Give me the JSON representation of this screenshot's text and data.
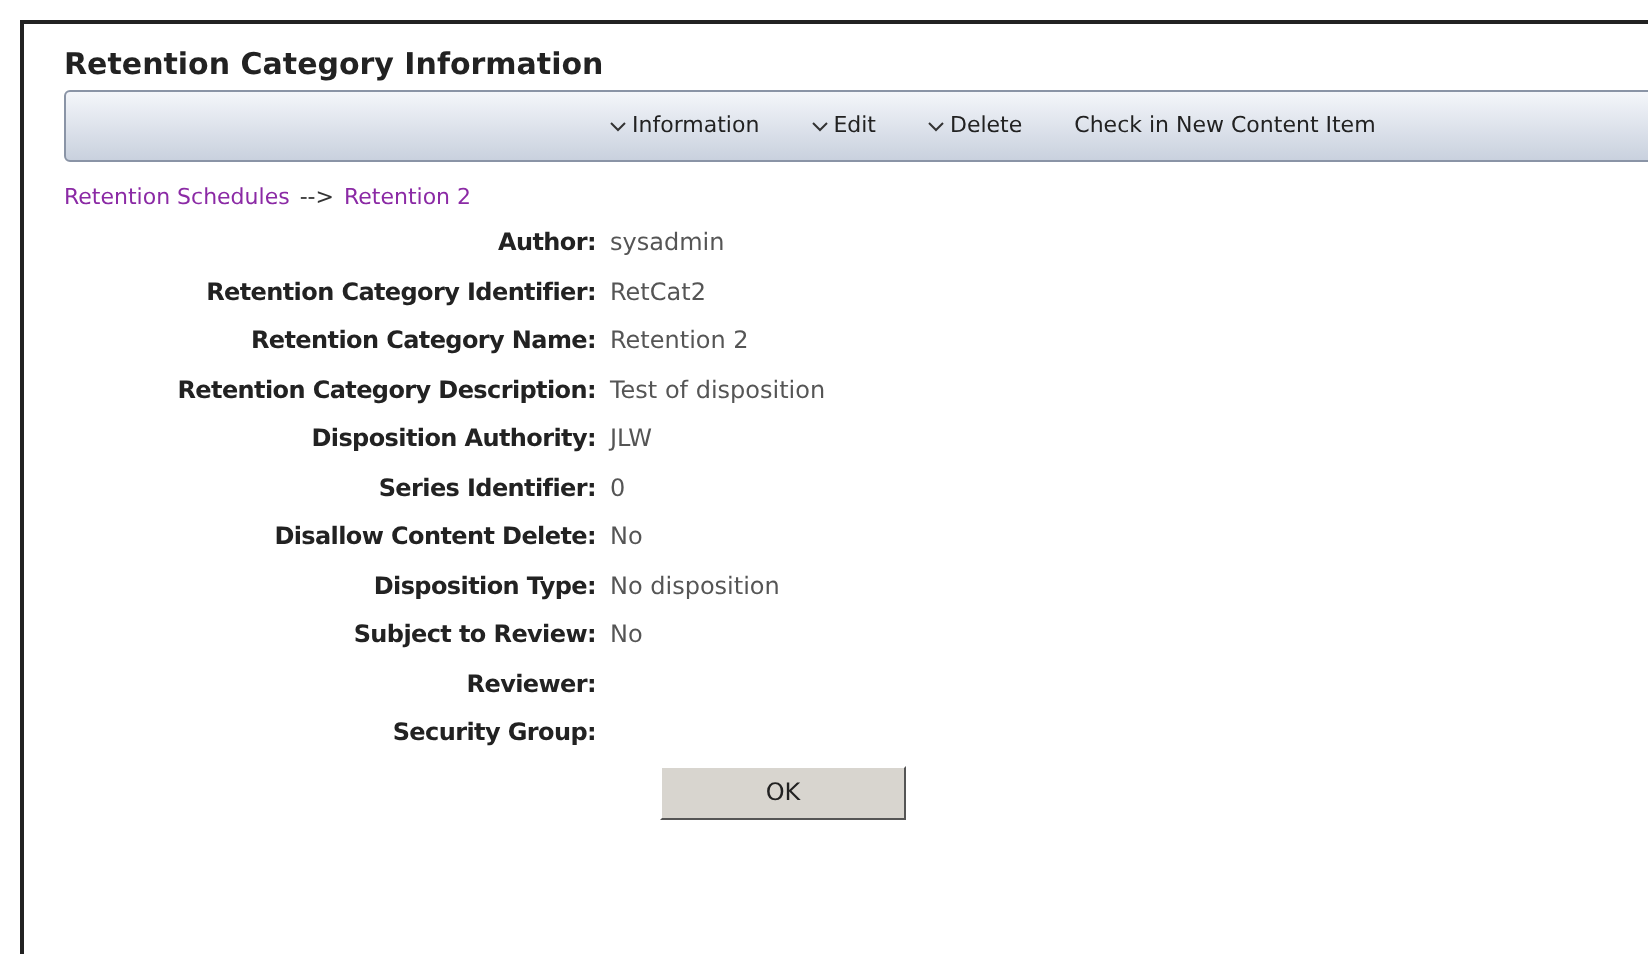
{
  "title": "Retention Category Information",
  "toolbar": [
    {
      "label": "Information",
      "kind": "dropdown"
    },
    {
      "label": "Edit",
      "kind": "dropdown"
    },
    {
      "label": "Delete",
      "kind": "dropdown"
    },
    {
      "label": "Check in New Content Item",
      "kind": "link"
    }
  ],
  "breadcrumb": [
    {
      "kind": "link",
      "text": "Retention Schedules"
    },
    {
      "kind": "separator",
      "text": "-->"
    },
    {
      "kind": "link",
      "text": "Retention 2"
    }
  ],
  "fields": [
    {
      "label": "Author:",
      "value": "sysadmin"
    },
    {
      "label": "Retention Category Identifier:",
      "value": "RetCat2"
    },
    {
      "label": "Retention Category Name:",
      "value": "Retention 2"
    },
    {
      "label": "Retention Category Description:",
      "value": "Test of disposition"
    },
    {
      "label": "Disposition Authority:",
      "value": "JLW"
    },
    {
      "label": "Series Identifier:",
      "value": "0"
    },
    {
      "label": "Disallow Content Delete:",
      "value": "No"
    },
    {
      "label": "Disposition Type:",
      "value": "No disposition"
    },
    {
      "label": "Subject to Review:",
      "value": "No"
    },
    {
      "label": "Reviewer:"
    },
    {
      "label": "Security Group:"
    }
  ],
  "buttons": [
    "OK"
  ]
}
